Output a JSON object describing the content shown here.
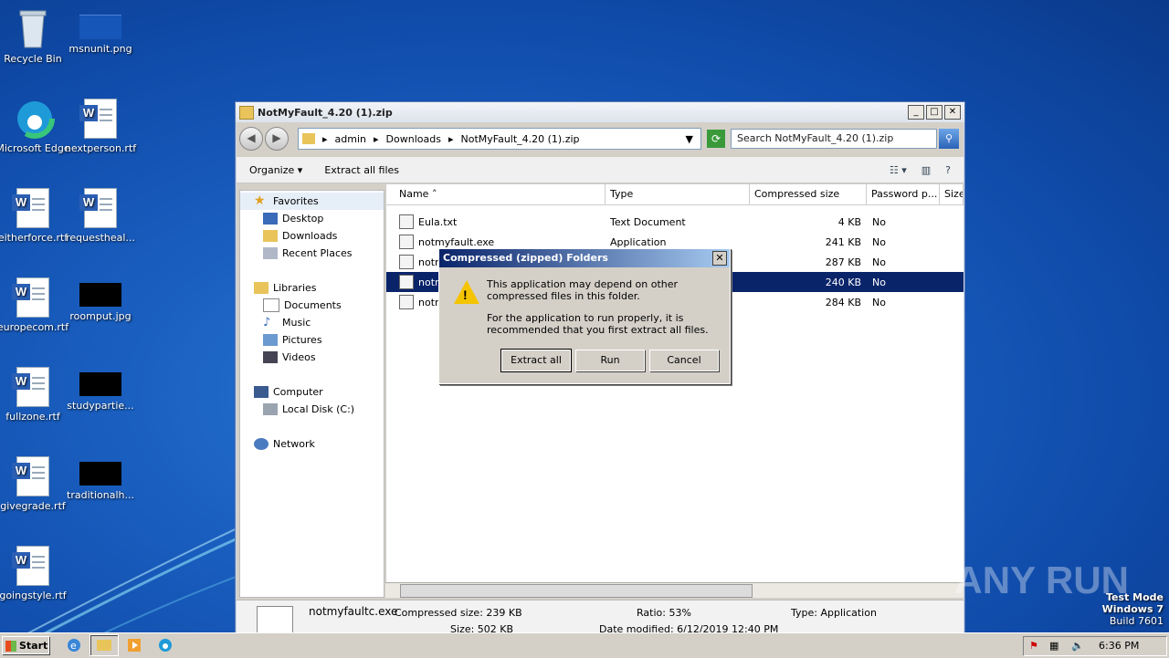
{
  "desktop": {
    "icons": [
      {
        "label": "Recycle Bin"
      },
      {
        "label": "msnunit.png"
      },
      {
        "label": "Microsoft Edge"
      },
      {
        "label": "nextperson.rtf"
      },
      {
        "label": "eitherforce.rtf"
      },
      {
        "label": "requesthеal..."
      },
      {
        "label": "europecom.rtf"
      },
      {
        "label": "roomput.jpg"
      },
      {
        "label": "fullzone.rtf"
      },
      {
        "label": "studypartie..."
      },
      {
        "label": "givegrade.rtf"
      },
      {
        "label": "traditionalh..."
      },
      {
        "label": "goingstyle.rtf"
      }
    ]
  },
  "window": {
    "title": "NotMyFault_4.20 (1).zip",
    "address": {
      "parts": [
        "admin",
        "Downloads",
        "NotMyFault_4.20 (1).zip"
      ]
    },
    "search_placeholder": "Search NotMyFault_4.20 (1).zip",
    "toolbar": {
      "organize": "Organize",
      "extract": "Extract all files"
    },
    "nav": {
      "favorites": "Favorites",
      "desktop": "Desktop",
      "downloads": "Downloads",
      "recent": "Recent Places",
      "libraries": "Libraries",
      "documents": "Documents",
      "music": "Music",
      "pictures": "Pictures",
      "videos": "Videos",
      "computer": "Computer",
      "localdisk": "Local Disk (C:)",
      "network": "Network"
    },
    "columns": {
      "name": "Name",
      "type": "Type",
      "compressed": "Compressed size",
      "password": "Password p...",
      "size": "Size"
    },
    "rows": [
      {
        "name": "Eula.txt",
        "type": "Text Document",
        "size": "4 KB",
        "pw": "No"
      },
      {
        "name": "notmyfault.exe",
        "type": "Application",
        "size": "241 KB",
        "pw": "No"
      },
      {
        "name": "notm",
        "type": "",
        "size": "287 KB",
        "pw": "No"
      },
      {
        "name": "notm",
        "type": "",
        "size": "240 KB",
        "pw": "No"
      },
      {
        "name": "notm",
        "type": "",
        "size": "284 KB",
        "pw": "No"
      }
    ],
    "details": {
      "filename": "notmyfaultc.exe",
      "compressed": "Compressed size: 239 KB",
      "ratio": "Ratio: 53%",
      "type": "Type: Application",
      "size": "Size: 502 KB",
      "date": "Date modified: 6/12/2019 12:40 PM"
    }
  },
  "dialog": {
    "title": "Compressed (zipped) Folders",
    "msg1": "This application may depend on other compressed files in this folder.",
    "msg2": "For the application to run properly, it is recommended that you first extract all files.",
    "extract": "Extract all",
    "run": "Run",
    "cancel": "Cancel"
  },
  "taskbar": {
    "start": "Start",
    "time": "6:36 PM"
  },
  "watermark": "ANY RUN",
  "testmode": {
    "line1": "Test Mode",
    "line2": "Windows 7",
    "line3": "Build 7601"
  }
}
